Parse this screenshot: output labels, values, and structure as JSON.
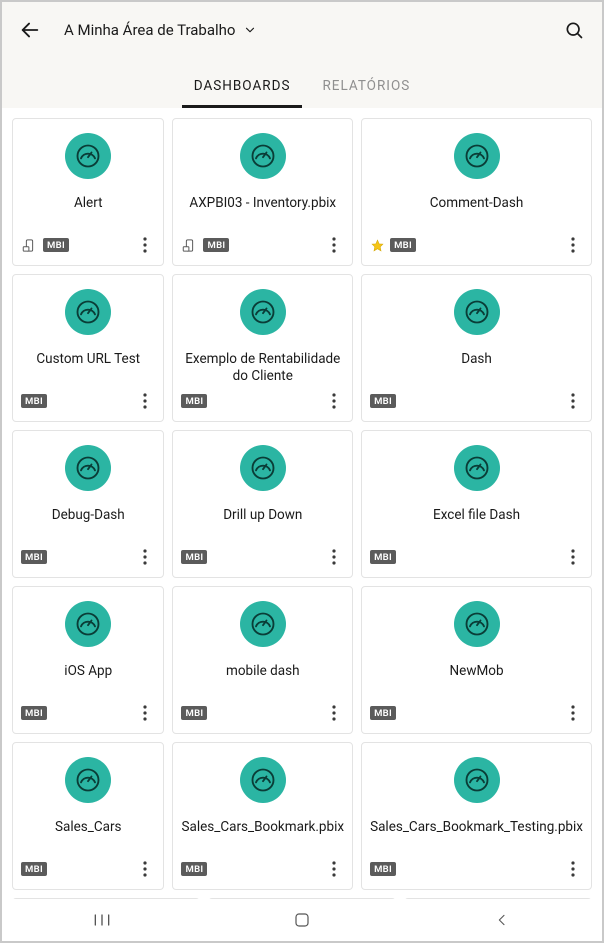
{
  "header": {
    "title": "A Minha Área de Trabalho"
  },
  "tabs": {
    "dashboards": "DASHBOARDS",
    "reports": "RELATÓRIOS",
    "active": "dashboards"
  },
  "badge_label": "MBI",
  "colors": {
    "accent": "#2bb5a3",
    "badge_bg": "#5b5b5b"
  },
  "items": [
    {
      "title": "Alert",
      "phone": true,
      "star": false,
      "badge": true
    },
    {
      "title": "AXPBI03 - Inventory.pbix",
      "phone": true,
      "star": false,
      "badge": true
    },
    {
      "title": "Comment-Dash",
      "phone": false,
      "star": true,
      "badge": true
    },
    {
      "title": "Custom URL Test",
      "phone": false,
      "star": false,
      "badge": true
    },
    {
      "title": "Exemplo de Rentabilidade do Cliente",
      "phone": false,
      "star": false,
      "badge": true
    },
    {
      "title": "Dash",
      "phone": false,
      "star": false,
      "badge": true
    },
    {
      "title": "Debug-Dash",
      "phone": false,
      "star": false,
      "badge": true
    },
    {
      "title": "Drill up Down",
      "phone": false,
      "star": false,
      "badge": true
    },
    {
      "title": "Excel file Dash",
      "phone": false,
      "star": false,
      "badge": true
    },
    {
      "title": "iOS App",
      "phone": false,
      "star": false,
      "badge": true
    },
    {
      "title": "mobile dash",
      "phone": false,
      "star": false,
      "badge": true
    },
    {
      "title": "NewMob",
      "phone": false,
      "star": false,
      "badge": true
    },
    {
      "title": "Sales_Cars",
      "phone": false,
      "star": false,
      "badge": true
    },
    {
      "title": "Sales_Cars_Bookmark.pbix",
      "phone": false,
      "star": false,
      "badge": true
    },
    {
      "title": "Sales_Cars_Bookmark_Testing.pbix",
      "phone": false,
      "star": false,
      "badge": true
    }
  ]
}
